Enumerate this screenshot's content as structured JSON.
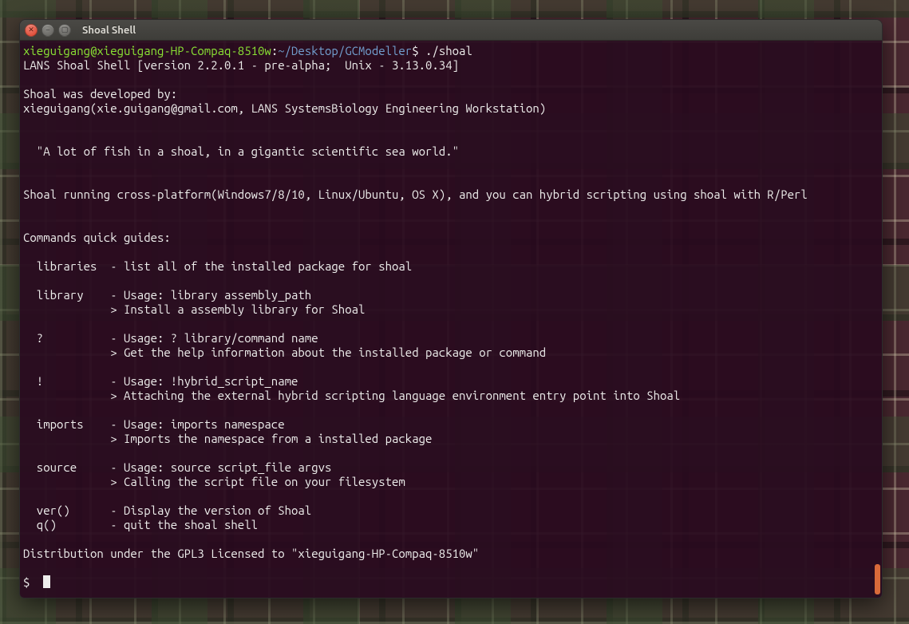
{
  "window": {
    "title": "Shoal Shell"
  },
  "prompt": {
    "userhost": "xieguigang@xieguigang-HP-Compaq-8510w",
    "sep1": ":",
    "path": "~/Desktop/GCModeller",
    "sym": "$ ",
    "command": "./shoal",
    "next_sym": "$  "
  },
  "banner": {
    "l1": "LANS Shoal Shell [version 2.2.0.1 - pre-alpha;  Unix - 3.13.0.34]",
    "l2": "",
    "l3": "Shoal was developed by:",
    "l4": "xieguigang(xie.guigang@gmail.com, LANS SystemsBiology Engineering Workstation)",
    "l5": "",
    "l6": "",
    "quote": "  \"A lot of fish in a shoal, in a gigantic scientific sea world.\"",
    "l7": "",
    "l8": "",
    "cross": "Shoal running cross-platform(Windows7/8/10, Linux/Ubuntu, OS X), and you can hybrid scripting using shoal with R/Perl",
    "l9": "",
    "l10": "",
    "guides_hdr": "Commands quick guides:",
    "l11": "",
    "g_libraries": "  libraries  - list all of the installed package for shoal",
    "l12": "",
    "g_library1": "  library    - Usage: library assembly_path",
    "g_library2": "             > Install a assembly library for Shoal",
    "l13": "",
    "g_q1": "  ?          - Usage: ? library/command name",
    "g_q2": "             > Get the help information about the installed package or command",
    "l14": "",
    "g_b1": "  !          - Usage: !hybrid_script_name",
    "g_b2": "             > Attaching the external hybrid scripting language environment entry point into Shoal",
    "l15": "",
    "g_imp1": "  imports    - Usage: imports namespace",
    "g_imp2": "             > Imports the namespace from a installed package",
    "l16": "",
    "g_src1": "  source     - Usage: source script_file argvs",
    "g_src2": "             > Calling the script file on your filesystem",
    "l17": "",
    "g_ver": "  ver()      - Display the version of Shoal",
    "g_quit": "  q()        - quit the shoal shell",
    "l18": "",
    "dist": "Distribution under the GPL3 Licensed to \"xieguigang-HP-Compaq-8510w\""
  },
  "colors": {
    "terminal_bg": "#300a24",
    "text": "#eeeeec",
    "prompt_user": "#8ae234",
    "prompt_path": "#729fcf",
    "scrollbar": "#d96a3a"
  }
}
